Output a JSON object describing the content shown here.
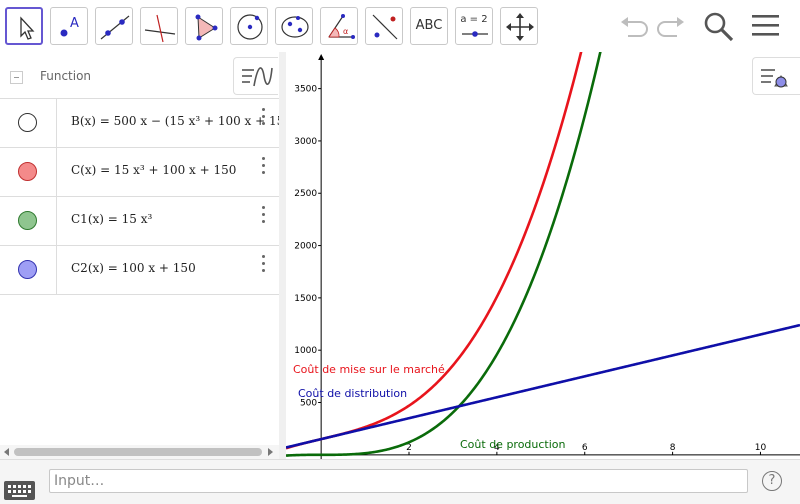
{
  "toolbar": {
    "tools": [
      {
        "name": "move-tool",
        "selected": true
      },
      {
        "name": "point-tool"
      },
      {
        "name": "line-tool"
      },
      {
        "name": "perpendicular-line-tool"
      },
      {
        "name": "polygon-tool"
      },
      {
        "name": "circle-center-tool"
      },
      {
        "name": "conic-tool"
      },
      {
        "name": "angle-tool"
      },
      {
        "name": "reflect-tool"
      },
      {
        "name": "text-tool",
        "label": "ABC"
      },
      {
        "name": "slider-tool",
        "label": "a = 2"
      },
      {
        "name": "move-graphics-view-tool"
      }
    ],
    "right_icons": [
      "undo-icon",
      "redo-icon",
      "search-icon",
      "menu-icon"
    ]
  },
  "algebra": {
    "header": "Function",
    "rows": [
      {
        "color": "#ffffff",
        "formula": "B(x) = 500 x − (15 x³ + 100 x + 150)"
      },
      {
        "color": "#f48a8a",
        "formula": "C(x) = 15 x³ + 100 x + 150"
      },
      {
        "color": "#8fc58f",
        "formula": "C1(x) = 15 x³"
      },
      {
        "color": "#9e9ef5",
        "formula": "C2(x) = 100 x + 150"
      }
    ]
  },
  "input": {
    "placeholder": "Input…",
    "value": ""
  },
  "help": "?",
  "chart_data": {
    "type": "line",
    "x_ticks": [
      2,
      4,
      6,
      8,
      10
    ],
    "y_ticks": [
      500,
      1000,
      1500,
      2000,
      2500,
      3000,
      3500
    ],
    "xlim": [
      -0.8,
      10.9
    ],
    "ylim": [
      -40,
      3850
    ],
    "series": [
      {
        "name": "Coût de mise sur le marché",
        "formula": "C(x) = 15 x³ + 100 x + 150",
        "color": "#e8141c"
      },
      {
        "name": "Coût de production",
        "formula": "C1(x) = 15 x³",
        "color": "#0a6b0a"
      },
      {
        "name": "Coût de distribution",
        "formula": "C2(x) = 100 x + 150",
        "color": "#0f0fa8"
      }
    ],
    "labels": [
      {
        "text": "Coût de mise sur le marché",
        "color": "#e8141c"
      },
      {
        "text": "Coût de distribution",
        "color": "#0f0fa8"
      },
      {
        "text": "Coût de production",
        "color": "#0a6b0a"
      }
    ]
  }
}
